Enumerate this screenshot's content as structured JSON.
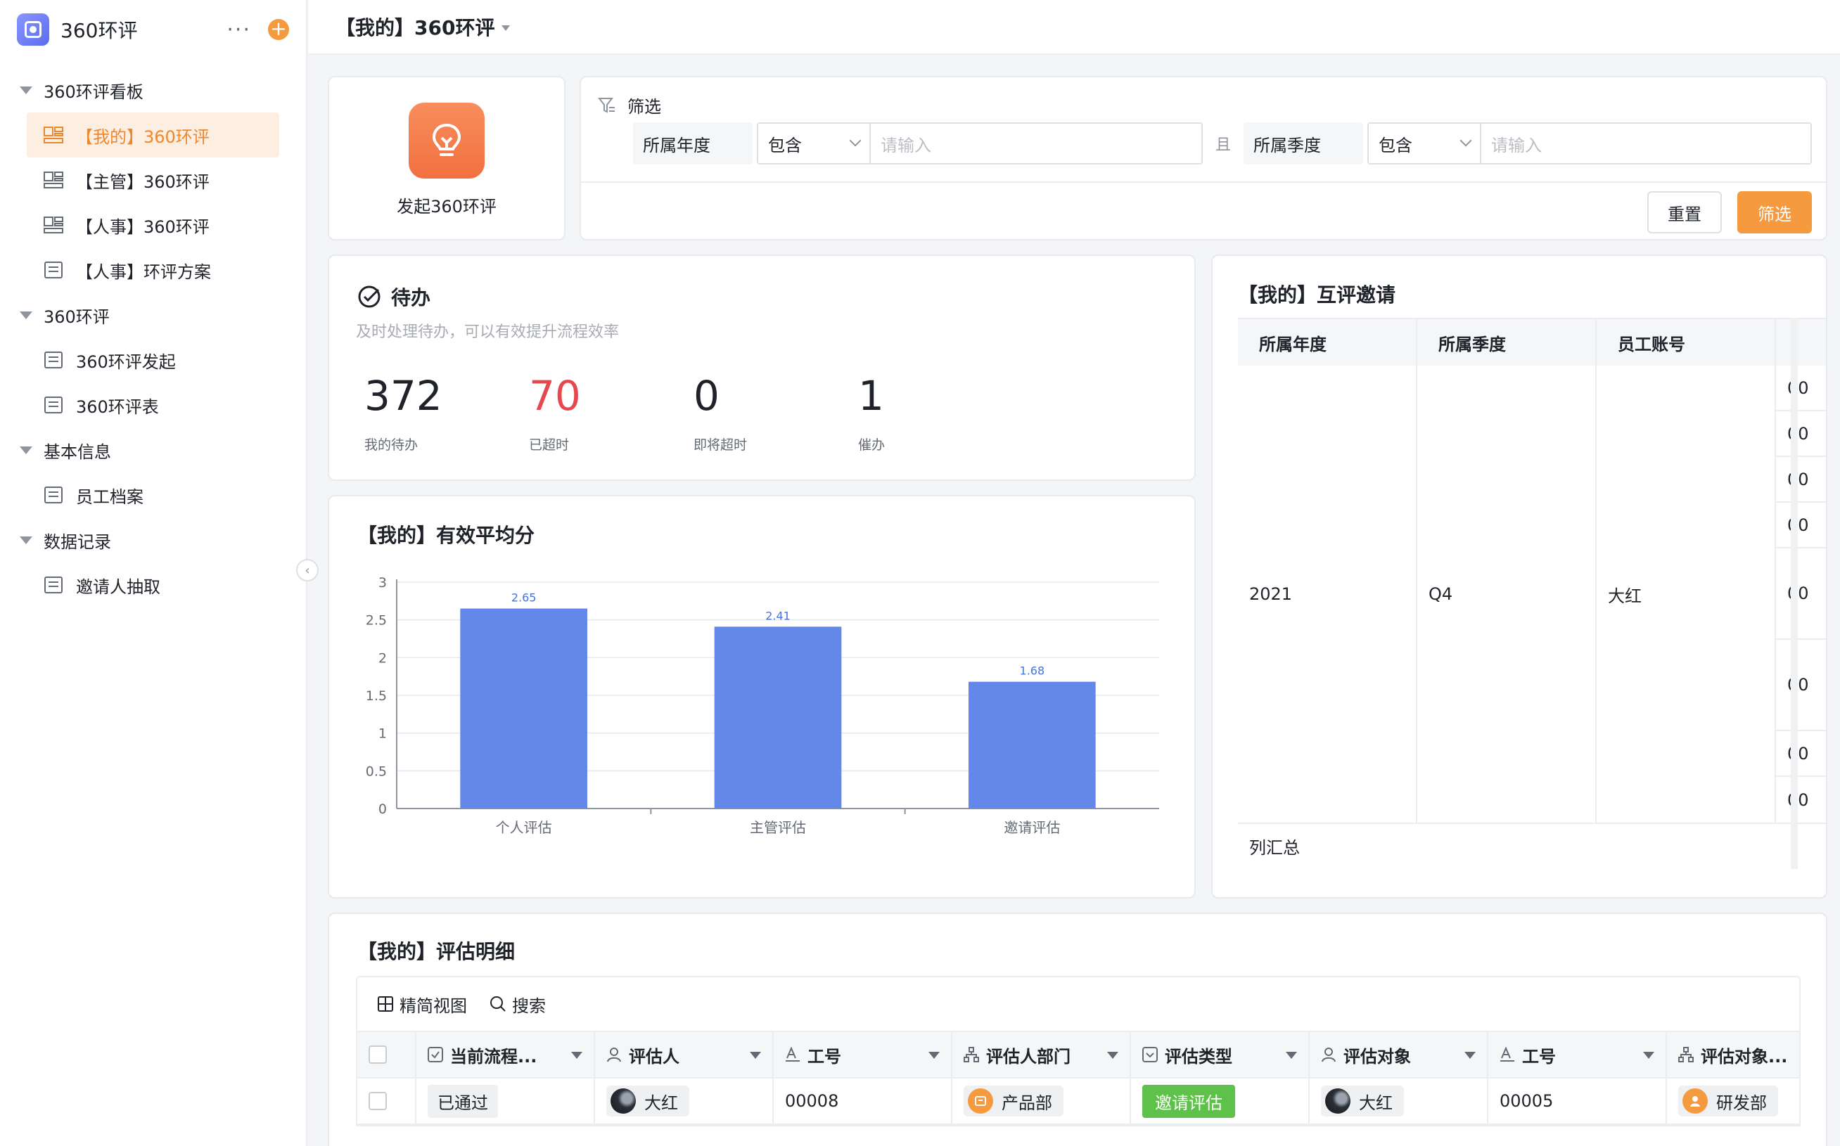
{
  "app": {
    "name": "360环评"
  },
  "sidebar": {
    "groups": [
      {
        "label": "360环评看板",
        "items": [
          {
            "label": "【我的】360环评",
            "active": true
          },
          {
            "label": "【主管】360环评"
          },
          {
            "label": "【人事】360环评"
          },
          {
            "label": "【人事】环评方案"
          }
        ]
      },
      {
        "label": "360环评",
        "items": [
          {
            "label": "360环评发起"
          },
          {
            "label": "360环评表"
          }
        ]
      },
      {
        "label": "基本信息",
        "items": [
          {
            "label": "员工档案"
          }
        ]
      },
      {
        "label": "数据记录",
        "items": [
          {
            "label": "邀请人抽取"
          }
        ]
      }
    ]
  },
  "page": {
    "title": "【我的】360环评"
  },
  "launch": {
    "label": "发起360环评"
  },
  "filter": {
    "title": "筛选",
    "conditions": [
      {
        "field": "所属年度",
        "op": "包含",
        "placeholder": "请输入"
      },
      {
        "field": "所属季度",
        "op": "包含",
        "placeholder": "请输入"
      }
    ],
    "and_label": "且",
    "reset_label": "重置",
    "submit_label": "筛选"
  },
  "todo": {
    "title": "待办",
    "subtitle": "及时处理待办，可以有效提升流程效率",
    "stats": [
      {
        "value": "372",
        "label": "我的待办",
        "color": "#1f2329"
      },
      {
        "value": "70",
        "label": "已超时",
        "color": "#e5484d"
      },
      {
        "value": "0",
        "label": "即将超时",
        "color": "#1f2329"
      },
      {
        "value": "1",
        "label": "催办",
        "color": "#1f2329"
      }
    ]
  },
  "avg_chart": {
    "title": "【我的】有效平均分"
  },
  "chart_data": {
    "type": "bar",
    "categories": [
      "个人评估",
      "主管评估",
      "邀请评估"
    ],
    "values": [
      2.65,
      2.41,
      1.68
    ],
    "data_labels": [
      "2.65",
      "2.41",
      "1.68"
    ],
    "y_ticks": [
      "0",
      "0.5",
      "1",
      "1.5",
      "2",
      "2.5",
      "3"
    ],
    "ylim": [
      0,
      3
    ],
    "bar_color": "#6388ea",
    "grid": true
  },
  "invite": {
    "title": "【我的】互评邀请",
    "columns": [
      "所属年度",
      "所属季度",
      "员工账号"
    ],
    "row": {
      "year": "2021",
      "quarter": "Q4",
      "account": "大红"
    },
    "sub_values": [
      "00",
      "00",
      "00",
      "00",
      "00",
      "00",
      "00",
      "00"
    ],
    "footer": "列汇总"
  },
  "detail": {
    "title": "【我的】评估明细",
    "toolbar": {
      "view": "精简视图",
      "search": "搜索"
    },
    "columns": [
      "当前流程...",
      "评估人",
      "工号",
      "评估人部门",
      "评估类型",
      "评估对象",
      "工号",
      "评估对象..."
    ],
    "row": {
      "status": "已通过",
      "evaluator": "大红",
      "evaluator_id": "00008",
      "evaluator_dept": "产品部",
      "type": "邀请评估",
      "target": "大红",
      "target_id": "00005",
      "target_dept": "研发部"
    },
    "colors": {
      "type_tag": "#5ec24a"
    }
  },
  "colors": {
    "accent": "#f59a3e",
    "overdue": "#e5484d"
  }
}
